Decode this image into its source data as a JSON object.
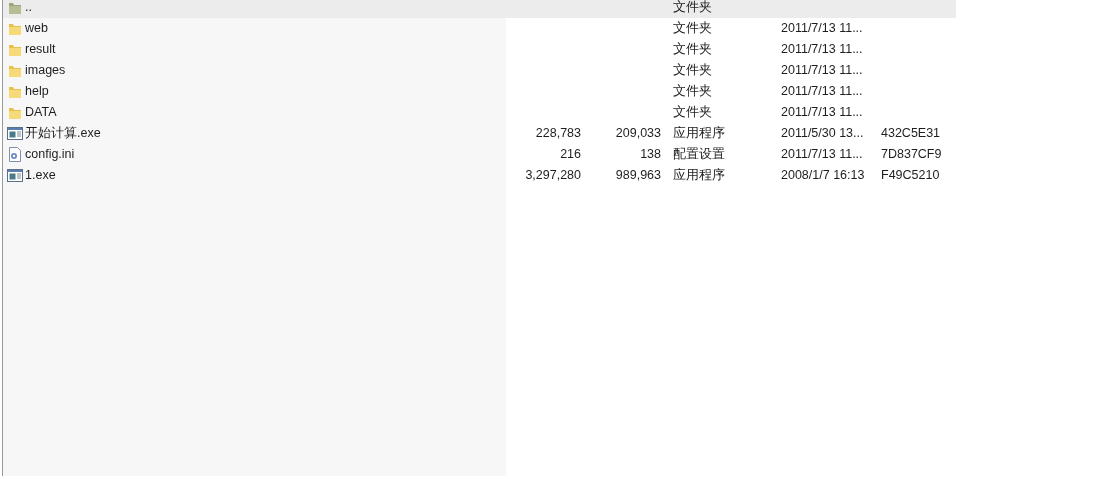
{
  "rows": [
    {
      "kind": "parent",
      "name": "..",
      "type": "文件夹",
      "selected": true
    },
    {
      "kind": "folder",
      "name": "web",
      "type": "文件夹",
      "modified": "2011/7/13 11...",
      "selected": false
    },
    {
      "kind": "folder",
      "name": "result",
      "type": "文件夹",
      "modified": "2011/7/13 11...",
      "selected": false
    },
    {
      "kind": "folder",
      "name": "images",
      "type": "文件夹",
      "modified": "2011/7/13 11...",
      "selected": false
    },
    {
      "kind": "folder",
      "name": "help",
      "type": "文件夹",
      "modified": "2011/7/13 11...",
      "selected": false
    },
    {
      "kind": "folder",
      "name": "DATA",
      "type": "文件夹",
      "modified": "2011/7/13 11...",
      "selected": false
    },
    {
      "kind": "exe",
      "name": "开始计算.exe",
      "size": "228,783",
      "packed": "209,033",
      "type": "应用程序",
      "modified": "2011/5/30 13...",
      "crc": "432C5E31",
      "selected": false
    },
    {
      "kind": "ini",
      "name": "config.ini",
      "size": "216",
      "packed": "138",
      "type": "配置设置",
      "modified": "2011/7/13 11...",
      "crc": "7D837CF9",
      "selected": false
    },
    {
      "kind": "exe",
      "name": "1.exe",
      "size": "3,297,280",
      "packed": "989,963",
      "type": "应用程序",
      "modified": "2008/1/7 16:13",
      "crc": "F49C5210",
      "selected": false
    }
  ]
}
